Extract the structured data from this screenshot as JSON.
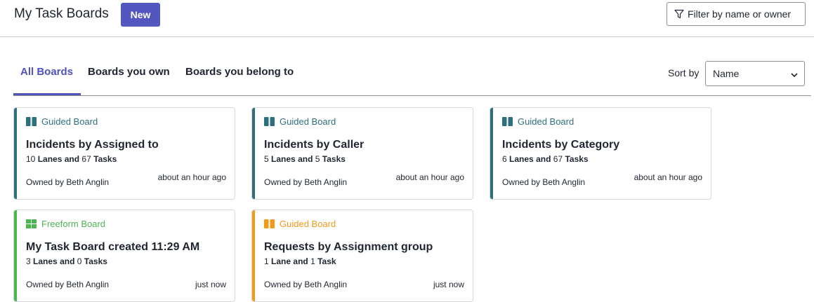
{
  "header": {
    "title": "My Task Boards",
    "new_label": "New",
    "filter_label": "Filter by name or owner"
  },
  "tabs": [
    {
      "label": "All Boards",
      "active": true
    },
    {
      "label": "Boards you own",
      "active": false
    },
    {
      "label": "Boards you belong to",
      "active": false
    }
  ],
  "sort": {
    "label": "Sort by",
    "value": "Name"
  },
  "colors": {
    "accent": "#5456c0",
    "guided_teal": "#2e6f7d",
    "freeform_green": "#4cb551",
    "guided_orange": "#f39a1b"
  },
  "cards": [
    {
      "type_label": "Guided Board",
      "type_icon": "columns-icon",
      "color": "#2e6f7d",
      "title": "Incidents by Assigned to",
      "lanes_count": "10",
      "lanes_word": "Lanes",
      "and_word": "and",
      "tasks_count": "67",
      "tasks_word": "Tasks",
      "owner": "Owned by Beth Anglin",
      "time": "about an hour ago"
    },
    {
      "type_label": "Guided Board",
      "type_icon": "columns-icon",
      "color": "#2e6f7d",
      "title": "Incidents by Caller",
      "lanes_count": "5",
      "lanes_word": "Lanes",
      "and_word": "and",
      "tasks_count": "5",
      "tasks_word": "Tasks",
      "owner": "Owned by Beth Anglin",
      "time": "about an hour ago"
    },
    {
      "type_label": "Guided Board",
      "type_icon": "columns-icon",
      "color": "#2e6f7d",
      "title": "Incidents by Category",
      "lanes_count": "6",
      "lanes_word": "Lanes",
      "and_word": "and",
      "tasks_count": "67",
      "tasks_word": "Tasks",
      "owner": "Owned by Beth Anglin",
      "time": "about an hour ago"
    },
    {
      "type_label": "Freeform Board",
      "type_icon": "grid-icon",
      "color": "#4cb551",
      "title": "My Task Board created 11:29 AM",
      "lanes_count": "3",
      "lanes_word": "Lanes",
      "and_word": "and",
      "tasks_count": "0",
      "tasks_word": "Tasks",
      "owner": "Owned by Beth Anglin",
      "time": "just now"
    },
    {
      "type_label": "Guided Board",
      "type_icon": "columns-icon",
      "color": "#f39a1b",
      "title": "Requests by Assignment group",
      "lanes_count": "1",
      "lanes_word": "Lane",
      "and_word": "and",
      "tasks_count": "1",
      "tasks_word": "Task",
      "owner": "Owned by Beth Anglin",
      "time": "just now"
    }
  ]
}
